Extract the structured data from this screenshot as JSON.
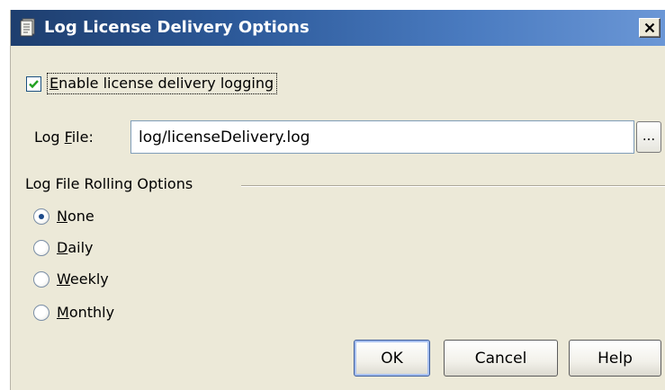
{
  "window": {
    "title": "Log License Delivery Options",
    "title_icon": "app-document-icon",
    "close_icon": "close-x-icon"
  },
  "logging": {
    "enable_label_mnemonic": "E",
    "enable_label_rest": "nable license delivery logging",
    "enabled": true
  },
  "log_file": {
    "label_prefix": "Log ",
    "label_mnemonic": "F",
    "label_suffix": "ile:",
    "value": "log/licenseDelivery.log",
    "browse_label": "..."
  },
  "rolling": {
    "group_title": "Log File Rolling Options",
    "selected": "None",
    "options": [
      {
        "mnemonic": "N",
        "rest": "one"
      },
      {
        "mnemonic": "D",
        "rest": "aily"
      },
      {
        "mnemonic": "W",
        "rest": "eekly"
      },
      {
        "mnemonic": "M",
        "rest": "onthly"
      }
    ]
  },
  "buttons": {
    "ok": "OK",
    "cancel": "Cancel",
    "help": "Help"
  }
}
